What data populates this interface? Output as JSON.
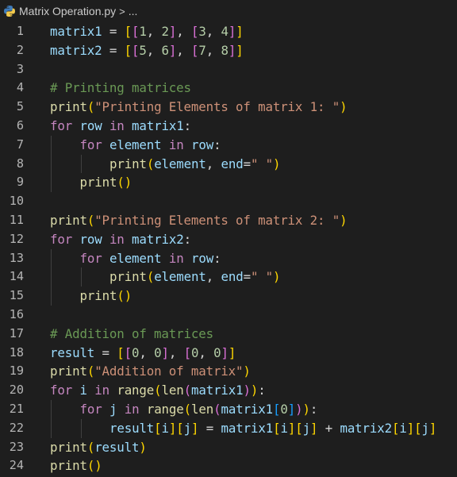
{
  "breadcrumb": {
    "file_icon": "python-icon",
    "file_name": "Matrix Operation.py",
    "separator": ">",
    "more": "..."
  },
  "editor": {
    "line_numbers": [
      "1",
      "2",
      "3",
      "4",
      "5",
      "6",
      "7",
      "8",
      "9",
      "10",
      "11",
      "12",
      "13",
      "14",
      "15",
      "16",
      "17",
      "18",
      "19",
      "20",
      "21",
      "22",
      "23",
      "24"
    ],
    "lines": [
      "matrix1 = [[1, 2], [3, 4]]",
      "matrix2 = [[5, 6], [7, 8]]",
      "",
      "# Printing matrices",
      "print(\"Printing Elements of matrix 1: \")",
      "for row in matrix1:",
      "    for element in row:",
      "        print(element, end=\" \")",
      "    print()",
      "",
      "print(\"Printing Elements of matrix 2: \")",
      "for row in matrix2:",
      "    for element in row:",
      "        print(element, end=\" \")",
      "    print()",
      "",
      "# Addition of matrices",
      "result = [[0, 0], [0, 0]]",
      "print(\"Addition of matrix\")",
      "for i in range(len(matrix1)):",
      "    for j in range(len(matrix1[0])):",
      "        result[i][j] = matrix1[i][j] + matrix2[i][j]",
      "print(result)",
      "print()"
    ]
  },
  "colors": {
    "background": "#1e1e1e",
    "variable": "#9cdcfe",
    "function": "#dcdcaa",
    "string": "#ce9178",
    "keyword": "#c586c0",
    "number": "#b5cea8",
    "comment": "#6a9955",
    "bracket_level_1": "#ffd700",
    "bracket_level_2": "#da70d6",
    "bracket_level_3": "#179fff"
  }
}
